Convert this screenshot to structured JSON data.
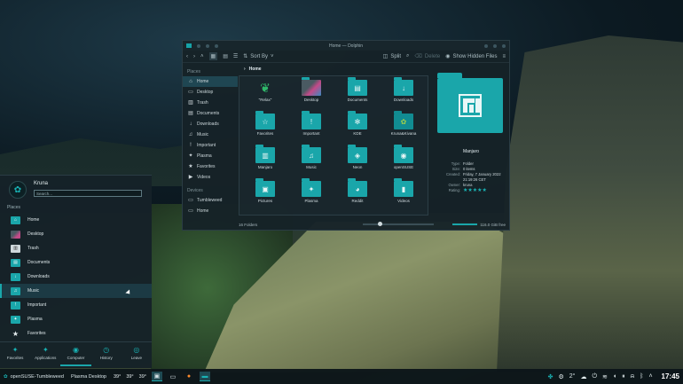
{
  "window": {
    "title": "Home — Dolphin",
    "toolbar": {
      "sort": "Sort By",
      "split": "Split",
      "delete": "Delete",
      "hidden": "Show Hidden Files"
    },
    "breadcrumb": "Home",
    "sidebar": {
      "places_heading": "Places",
      "places": [
        "Home",
        "Desktop",
        "Trash",
        "Documents",
        "Downloads",
        "Music",
        "Important",
        "Plasma",
        "Favorites",
        "Videos"
      ],
      "devices_heading": "Devices",
      "devices": [
        "Tumbleweed",
        "Home"
      ]
    },
    "items": [
      {
        "label": "\"Relax\"",
        "icon": "cannabis-leaf-icon"
      },
      {
        "label": "Desktop",
        "icon": "desktop-folder-icon"
      },
      {
        "label": "Documents",
        "icon": "documents-folder-icon"
      },
      {
        "label": "Downloads",
        "icon": "download-folder-icon"
      },
      {
        "label": "Favorites",
        "icon": "star-folder-icon"
      },
      {
        "label": "Important",
        "icon": "important-folder-icon"
      },
      {
        "label": "KDE",
        "icon": "kde-folder-icon"
      },
      {
        "label": "Kruna&Kivana",
        "icon": "image-icon"
      },
      {
        "label": "Manjaro",
        "icon": "manjaro-folder-icon"
      },
      {
        "label": "Music",
        "icon": "music-folder-icon"
      },
      {
        "label": "Neon",
        "icon": "neon-folder-icon"
      },
      {
        "label": "openSUSE",
        "icon": "opensuse-folder-icon"
      },
      {
        "label": "Pictures",
        "icon": "pictures-folder-icon"
      },
      {
        "label": "Plasma",
        "icon": "plasma-folder-icon"
      },
      {
        "label": "Reddit",
        "icon": "reddit-folder-icon"
      },
      {
        "label": "Videos",
        "icon": "videos-folder-icon"
      }
    ],
    "preview": {
      "name": "Manjaro",
      "rows": [
        {
          "k": "Type:",
          "v": "Folder"
        },
        {
          "k": "Size:",
          "v": "0 items"
        },
        {
          "k": "Created:",
          "v": "Friday, 7 January 2022 21:19:26 CET"
        },
        {
          "k": "Owner:",
          "v": "kruna"
        },
        {
          "k": "Rating:",
          "v": "★★★★★"
        }
      ]
    },
    "status": {
      "count": "16 Folders",
      "free": "116.0 GiB free"
    }
  },
  "launcher": {
    "user": "Kruna",
    "search_placeholder": "Search...",
    "places_heading": "Places",
    "places": [
      {
        "label": "Home",
        "icon": "home-folder-icon",
        "glyph": "⌂"
      },
      {
        "label": "Desktop",
        "icon": "desktop-folder-icon",
        "glyph": ""
      },
      {
        "label": "Trash",
        "icon": "trash-icon",
        "glyph": "▥"
      },
      {
        "label": "Documents",
        "icon": "documents-folder-icon",
        "glyph": "▤"
      },
      {
        "label": "Downloads",
        "icon": "download-folder-icon",
        "glyph": "↓"
      },
      {
        "label": "Music",
        "icon": "music-folder-icon",
        "glyph": "♫"
      },
      {
        "label": "Important",
        "icon": "important-folder-icon",
        "glyph": "!"
      },
      {
        "label": "Plasma",
        "icon": "plasma-folder-icon",
        "glyph": "✦"
      },
      {
        "label": "Favorites",
        "icon": "star-icon",
        "glyph": "★"
      }
    ],
    "tabs": [
      "Favorites",
      "Applications",
      "Computer",
      "History",
      "Leave"
    ]
  },
  "taskbar": {
    "distro": "openSUSE-Tumbleweed",
    "desktop": "Plasma Desktop",
    "temps": [
      "39°",
      "39°",
      "39°"
    ],
    "weather": "2°",
    "clock": "17:45"
  },
  "colors": {
    "accent": "#1aa6aa"
  }
}
